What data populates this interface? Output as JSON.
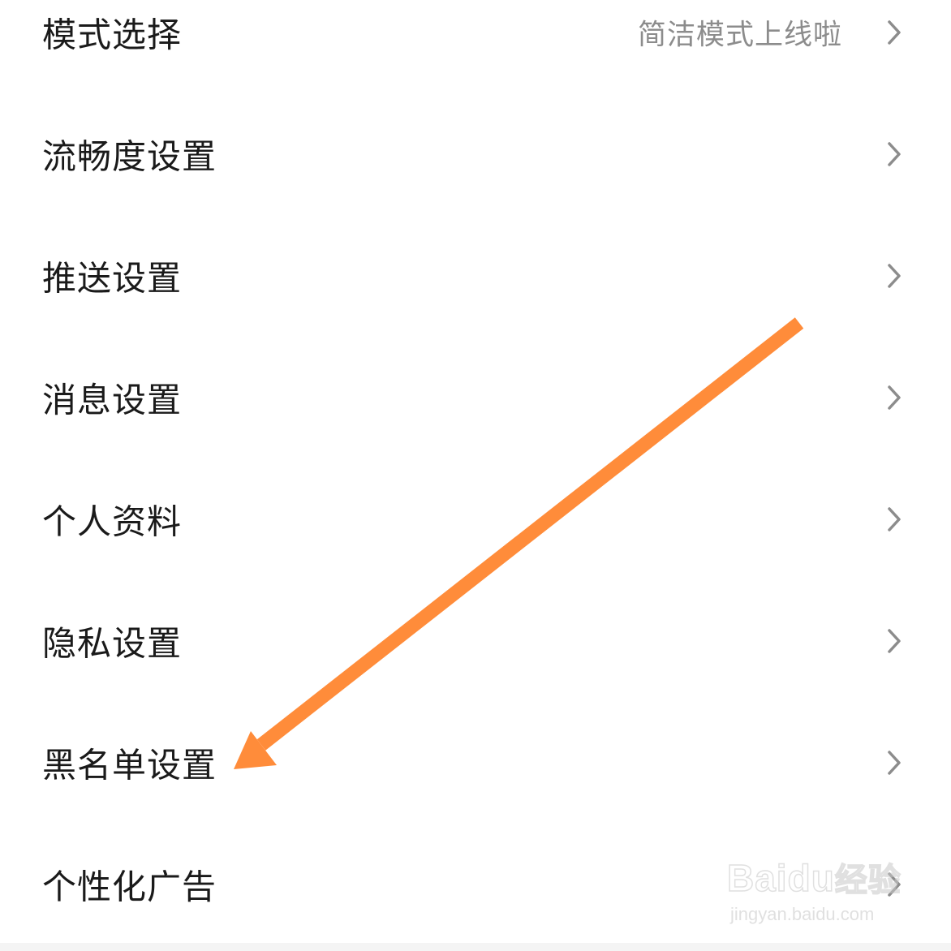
{
  "settings": {
    "items": [
      {
        "label": "模式选择",
        "value": "简洁模式上线啦"
      },
      {
        "label": "流畅度设置",
        "value": ""
      },
      {
        "label": "推送设置",
        "value": ""
      },
      {
        "label": "消息设置",
        "value": ""
      },
      {
        "label": "个人资料",
        "value": ""
      },
      {
        "label": "隐私设置",
        "value": ""
      },
      {
        "label": "黑名单设置",
        "value": ""
      },
      {
        "label": "个性化广告",
        "value": ""
      }
    ]
  },
  "annotation": {
    "arrow_color": "#ff8c3a",
    "target": "黑名单设置"
  },
  "watermark": {
    "logo_text": "Bai",
    "logo_paw": "du",
    "logo_suffix": "经验",
    "url": "jingyan.baidu.com"
  },
  "icons": {
    "chevron": "chevron-right-icon"
  }
}
